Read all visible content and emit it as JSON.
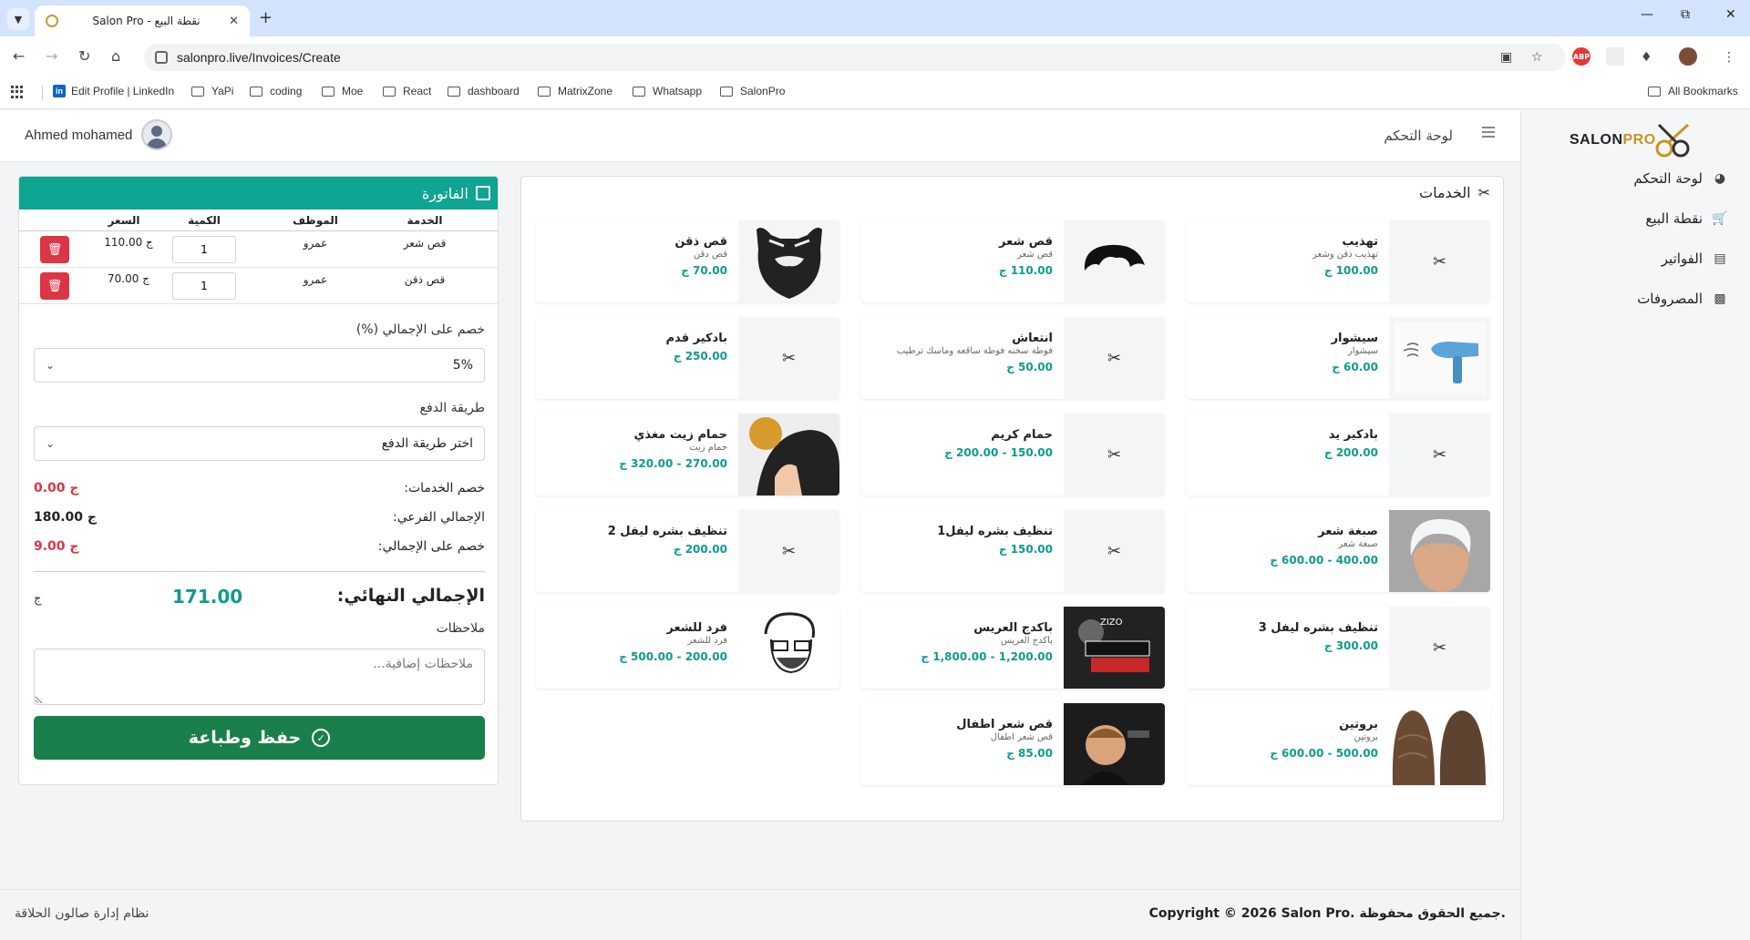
{
  "browser": {
    "tab_title": "Salon Pro - نقطة البيع",
    "url": "salonpro.live/Invoices/Create",
    "bookmarks": [
      "Edit Profile | LinkedIn",
      "YaPi",
      "coding",
      "Moe",
      "React",
      "dashboard",
      "MatrixZone",
      "Whatsapp",
      "SalonPro"
    ],
    "all_bookmarks": "All Bookmarks"
  },
  "sidebar": {
    "logo_text": "SALON",
    "logo_accent": "PRO",
    "items": [
      {
        "label": "لوحة التحكم",
        "icon": "dashboard-icon"
      },
      {
        "label": "نقطة البيع",
        "icon": "cart-icon"
      },
      {
        "label": "الفواتير",
        "icon": "invoice-icon"
      },
      {
        "label": "المصروفات",
        "icon": "expenses-icon"
      }
    ]
  },
  "topbar": {
    "title": "لوحة التحكم",
    "user_name": "Ahmed mohamed"
  },
  "services": {
    "title": "الخدمات",
    "items": [
      {
        "name": "تهذيب",
        "desc": "تهذيب دقن وشعر",
        "price": "100.00 ج",
        "thumb": "scissors"
      },
      {
        "name": "قص شعر",
        "desc": "قص شعر",
        "price": "110.00 ج",
        "thumb": "hair"
      },
      {
        "name": "قص ذقن",
        "desc": "قص دقن",
        "price": "70.00 ج",
        "thumb": "beard"
      },
      {
        "name": "سيشوار",
        "desc": "سيشوار",
        "price": "60.00 ج",
        "thumb": "dryer"
      },
      {
        "name": "انتعاش",
        "desc": "فوطة سخنه فوطة ساقعه وماسك ترطيب",
        "price": "50.00 ج",
        "thumb": "scissors"
      },
      {
        "name": "بادكير قدم",
        "desc": "",
        "price": "250.00 ج",
        "thumb": "scissors"
      },
      {
        "name": "بادكير يد",
        "desc": "",
        "price": "200.00 ج",
        "thumb": "scissors"
      },
      {
        "name": "حمام كريم",
        "desc": "",
        "price": "150.00 - 200.00 ج",
        "thumb": "scissors"
      },
      {
        "name": "حمام زيت مغذي",
        "desc": "حمام زيت",
        "price": "270.00 - 320.00 ج",
        "thumb": "oil"
      },
      {
        "name": "صبغة شعر",
        "desc": "صبغة شعر",
        "price": "400.00 - 600.00 ج",
        "thumb": "dye"
      },
      {
        "name": "تنظيف بشره ليفل1",
        "desc": "",
        "price": "150.00 ج",
        "thumb": "scissors"
      },
      {
        "name": "تنظيف بشره ليفل 2",
        "desc": "",
        "price": "200.00 ج",
        "thumb": "scissors"
      },
      {
        "name": "تنظيف بشره ليفل 3",
        "desc": "",
        "price": "300.00 ج",
        "thumb": "scissors"
      },
      {
        "name": "باكدج العريس",
        "desc": "باكدج العريس",
        "price": "1,200.00 - 1,800.00 ج",
        "thumb": "groom"
      },
      {
        "name": "فرد للشعر",
        "desc": "فرد للشعر",
        "price": "200.00 - 500.00 ج",
        "thumb": "sketch"
      },
      {
        "name": "بروتين",
        "desc": "بروتين",
        "price": "500.00 - 600.00 ج",
        "thumb": "protein"
      },
      {
        "name": "قص شعر اطفال",
        "desc": "قص شعر اطفال",
        "price": "85.00 ج",
        "thumb": "kids"
      }
    ]
  },
  "invoice": {
    "title": "الفاتورة",
    "headers": {
      "service": "الخدمة",
      "employee": "الموظف",
      "qty": "الكمية",
      "price": "السعر"
    },
    "rows": [
      {
        "service": "قص شعر",
        "employee": "عمرو",
        "qty": "1",
        "price": "110.00 ج"
      },
      {
        "service": "قص ذقن",
        "employee": "عمرو",
        "qty": "1",
        "price": "70.00 ج"
      }
    ],
    "discount_label": "خصم على الإجمالي (%)",
    "discount_value": "5%",
    "payment_label": "طريقة الدفع",
    "payment_value": "اختر طريقة الدفع",
    "services_discount_label": "خصم الخدمات:",
    "services_discount_value": "0.00 ج",
    "subtotal_label": "الإجمالي الفرعي:",
    "subtotal_value": "180.00 ج",
    "total_discount_label": "خصم على الإجمالي:",
    "total_discount_value": "9.00 ج",
    "grand_label": "الإجمالي النهائي:",
    "grand_value": "171.00",
    "currency": "ج",
    "notes_label": "ملاحظات",
    "notes_placeholder": "ملاحظات إضافية...",
    "save_label": "حفظ وطباعة"
  },
  "footer": {
    "left": "نظام إدارة صالون الحلاقة",
    "right": "Copyright © 2026 Salon Pro. جميع الحقوق محفوظة."
  },
  "colors": {
    "accent": "#0fa593",
    "price": "#0f9b8e",
    "danger": "#dc3545",
    "save": "#1b7f4b",
    "discount_red": "#dc3545"
  }
}
